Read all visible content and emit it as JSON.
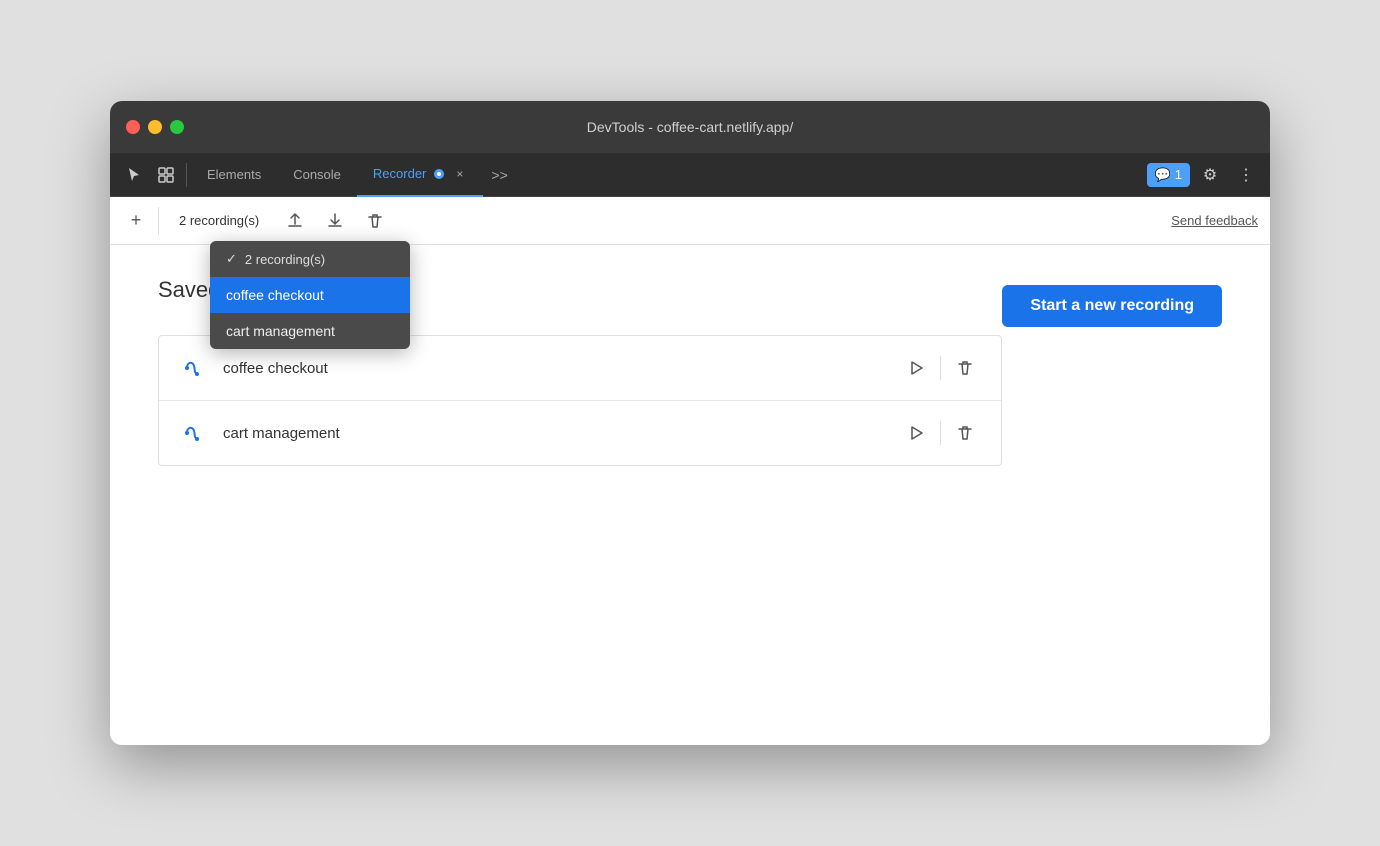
{
  "window": {
    "title": "DevTools - coffee-cart.netlify.app/"
  },
  "tabs": {
    "items": [
      {
        "label": "Elements",
        "active": false
      },
      {
        "label": "Console",
        "active": false
      },
      {
        "label": "Recorder",
        "active": true
      }
    ],
    "more_label": ">>",
    "close_label": "×"
  },
  "toolbar": {
    "add_label": "+",
    "recording_count": "2 recording(s)",
    "send_feedback_label": "Send feedback"
  },
  "dropdown": {
    "header": "2 recording(s)",
    "items": [
      {
        "label": "coffee checkout",
        "selected": true
      },
      {
        "label": "cart management",
        "selected": false
      }
    ]
  },
  "content": {
    "saved_recordings_label": "Saved recordings",
    "start_recording_label": "Start a new recording",
    "recordings": [
      {
        "name": "coffee checkout"
      },
      {
        "name": "cart management"
      }
    ]
  },
  "icons": {
    "cursor": "⬡",
    "layers": "⧉",
    "checkmark": "✓",
    "play": "▷",
    "trash": "🗑",
    "upload": "⬆",
    "download": "⬇",
    "settings": "⚙",
    "more": "⋮",
    "badge_count": "1"
  }
}
